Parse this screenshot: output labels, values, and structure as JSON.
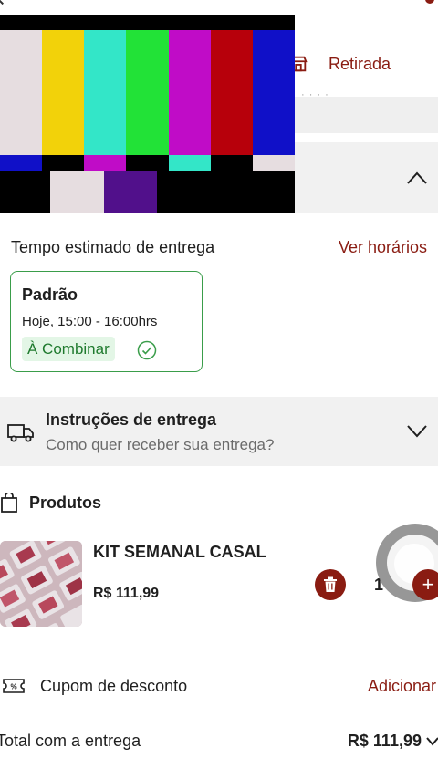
{
  "header": {
    "pickup_label": "Retirada",
    "partial_subtext": "· ·   ·  ·"
  },
  "video_overlay": {
    "top_bars": [
      "#e6dde0",
      "#f2d20a",
      "#33e6c8",
      "#22e237",
      "#c00cc7",
      "#b7000b",
      "#1010c8"
    ],
    "mid_bars": [
      "#1010c8",
      "#000000",
      "#c00cc7",
      "#000000",
      "#33e6c8",
      "#000000",
      "#e6dde0"
    ]
  },
  "delivery": {
    "label": "Tempo estimado de entrega",
    "schedule_link": "Ver horários",
    "option": {
      "title": "Padrão",
      "time": "Hoje, 15:00 - 16:00hrs",
      "badge": "À Combinar"
    }
  },
  "instructions": {
    "title": "Instruções de entrega",
    "subtitle": "Como quer receber sua entrega?"
  },
  "products": {
    "title": "Produtos",
    "items": [
      {
        "name": "KIT SEMANAL CASAL",
        "price": "R$ 111,99",
        "quantity": "1"
      }
    ]
  },
  "coupon": {
    "label": "Cupom de desconto",
    "action": "Adicionar"
  },
  "total": {
    "label": "Total com a entrega",
    "value": "R$ 111,99"
  },
  "colors": {
    "brand": "#8a1c12",
    "success": "#3a9d4a",
    "success_bg": "#e3f6e6"
  }
}
